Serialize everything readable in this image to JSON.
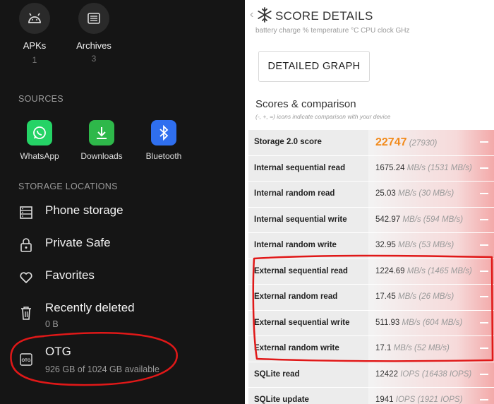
{
  "left": {
    "categories": [
      {
        "label": "APKs",
        "count": "1",
        "icon": "android-icon"
      },
      {
        "label": "Archives",
        "count": "3",
        "icon": "archive-icon"
      }
    ],
    "sources_header": "SOURCES",
    "sources": [
      {
        "label": "WhatsApp",
        "icon": "whatsapp-icon",
        "color": "#25D366"
      },
      {
        "label": "Downloads",
        "icon": "download-icon",
        "color": "#2EB84A"
      },
      {
        "label": "Bluetooth",
        "icon": "bluetooth-icon",
        "color": "#2F6FEF"
      }
    ],
    "storage_header": "STORAGE LOCATIONS",
    "locations": [
      {
        "title": "Phone storage",
        "sub": "",
        "icon": "phone-storage-icon"
      },
      {
        "title": "Private Safe",
        "sub": "",
        "icon": "lock-icon"
      },
      {
        "title": "Favorites",
        "sub": "",
        "icon": "heart-icon"
      },
      {
        "title": "Recently deleted",
        "sub": "0 B",
        "icon": "trash-icon"
      },
      {
        "title": "OTG",
        "sub": "926 GB of 1024 GB available",
        "icon": "otg-icon"
      }
    ]
  },
  "right": {
    "title": "SCORE DETAILS",
    "partial_header": "battery charge %     temperature °C        CPU clock GHz",
    "graph_button": "DETAILED GRAPH",
    "scores_title": "Scores & comparison",
    "scores_hint": "(-, +, =) icons indicate comparison with your device",
    "storage_score": {
      "label": "Storage 2.0 score",
      "value": "22747",
      "compare": "(27930)"
    },
    "rows": [
      {
        "label": "Internal sequential read",
        "value": "1675.24",
        "unit": "MB/s",
        "compare": "(1531 MB/s)"
      },
      {
        "label": "Internal random read",
        "value": "25.03",
        "unit": "MB/s",
        "compare": "(30 MB/s)"
      },
      {
        "label": "Internal sequential write",
        "value": "542.97",
        "unit": "MB/s",
        "compare": "(594 MB/s)"
      },
      {
        "label": "Internal random write",
        "value": "32.95",
        "unit": "MB/s",
        "compare": "(53 MB/s)"
      },
      {
        "label": "External sequential read",
        "value": "1224.69",
        "unit": "MB/s",
        "compare": "(1465 MB/s)"
      },
      {
        "label": "External random read",
        "value": "17.45",
        "unit": "MB/s",
        "compare": "(26 MB/s)"
      },
      {
        "label": "External sequential write",
        "value": "511.93",
        "unit": "MB/s",
        "compare": "(604 MB/s)"
      },
      {
        "label": "External random write",
        "value": "17.1",
        "unit": "MB/s",
        "compare": "(52 MB/s)"
      },
      {
        "label": "SQLite read",
        "value": "12422",
        "unit": "IOPS",
        "compare": "(16438 IOPS)"
      },
      {
        "label": "SQLite update",
        "value": "1941",
        "unit": "IOPS",
        "compare": "(1921 IOPS)"
      }
    ]
  },
  "annotation_color": "#e01818"
}
